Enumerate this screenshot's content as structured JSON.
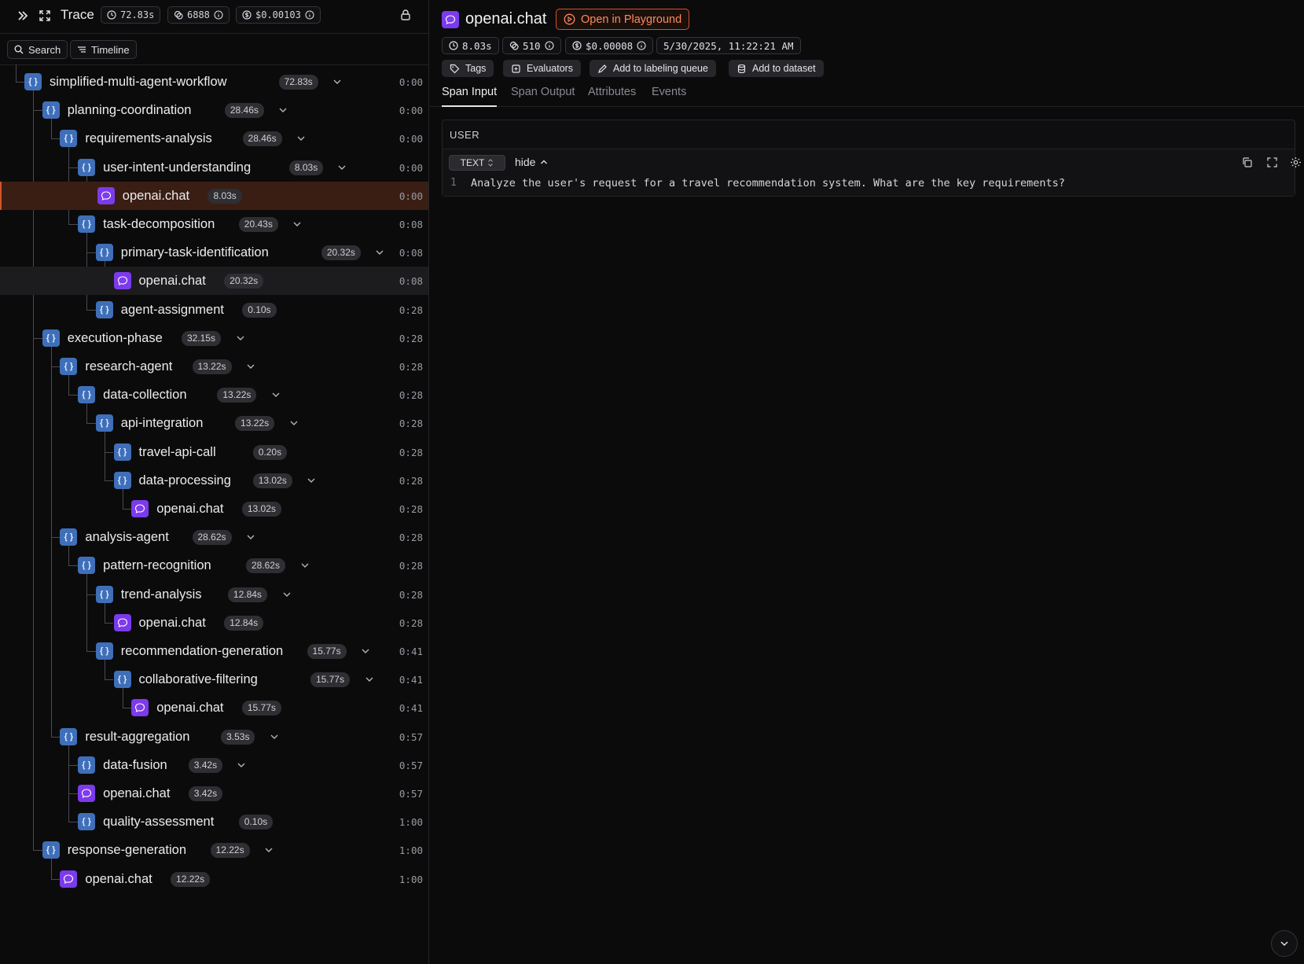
{
  "topbar": {
    "title": "Trace",
    "duration": "72.83s",
    "tokens": "6888",
    "cost": "$0.00103"
  },
  "subbar": {
    "search_label": "Search",
    "timeline_label": "Timeline"
  },
  "tree": [
    {
      "name": "simplified-multi-agent-workflow",
      "kind": "fn",
      "dur": "72.83s",
      "ts": "0:00",
      "expand": true
    },
    {
      "name": "planning-coordination",
      "kind": "fn",
      "dur": "28.46s",
      "ts": "0:00",
      "expand": true
    },
    {
      "name": "requirements-analysis",
      "kind": "fn",
      "dur": "28.46s",
      "ts": "0:00",
      "expand": true
    },
    {
      "name": "user-intent-understanding",
      "kind": "fn",
      "dur": "8.03s",
      "ts": "0:00",
      "expand": true
    },
    {
      "name": "openai.chat",
      "kind": "chat",
      "dur": "8.03s",
      "ts": "0:00",
      "expand": false
    },
    {
      "name": "task-decomposition",
      "kind": "fn",
      "dur": "20.43s",
      "ts": "0:08",
      "expand": true
    },
    {
      "name": "primary-task-identification",
      "kind": "fn",
      "dur": "20.32s",
      "ts": "0:08",
      "expand": true
    },
    {
      "name": "openai.chat",
      "kind": "chat",
      "dur": "20.32s",
      "ts": "0:08",
      "expand": false
    },
    {
      "name": "agent-assignment",
      "kind": "fn",
      "dur": "0.10s",
      "ts": "0:28",
      "expand": false
    },
    {
      "name": "execution-phase",
      "kind": "fn",
      "dur": "32.15s",
      "ts": "0:28",
      "expand": true
    },
    {
      "name": "research-agent",
      "kind": "fn",
      "dur": "13.22s",
      "ts": "0:28",
      "expand": true
    },
    {
      "name": "data-collection",
      "kind": "fn",
      "dur": "13.22s",
      "ts": "0:28",
      "expand": true
    },
    {
      "name": "api-integration",
      "kind": "fn",
      "dur": "13.22s",
      "ts": "0:28",
      "expand": true
    },
    {
      "name": "travel-api-call",
      "kind": "fn",
      "dur": "0.20s",
      "ts": "0:28",
      "expand": false
    },
    {
      "name": "data-processing",
      "kind": "fn",
      "dur": "13.02s",
      "ts": "0:28",
      "expand": true
    },
    {
      "name": "openai.chat",
      "kind": "chat",
      "dur": "13.02s",
      "ts": "0:28",
      "expand": false
    },
    {
      "name": "analysis-agent",
      "kind": "fn",
      "dur": "28.62s",
      "ts": "0:28",
      "expand": true
    },
    {
      "name": "pattern-recognition",
      "kind": "fn",
      "dur": "28.62s",
      "ts": "0:28",
      "expand": true
    },
    {
      "name": "trend-analysis",
      "kind": "fn",
      "dur": "12.84s",
      "ts": "0:28",
      "expand": true
    },
    {
      "name": "openai.chat",
      "kind": "chat",
      "dur": "12.84s",
      "ts": "0:28",
      "expand": false
    },
    {
      "name": "recommendation-generation",
      "kind": "fn",
      "dur": "15.77s",
      "ts": "0:41",
      "expand": true
    },
    {
      "name": "collaborative-filtering",
      "kind": "fn",
      "dur": "15.77s",
      "ts": "0:41",
      "expand": true
    },
    {
      "name": "openai.chat",
      "kind": "chat",
      "dur": "15.77s",
      "ts": "0:41",
      "expand": false
    },
    {
      "name": "result-aggregation",
      "kind": "fn",
      "dur": "3.53s",
      "ts": "0:57",
      "expand": true
    },
    {
      "name": "data-fusion",
      "kind": "fn",
      "dur": "3.42s",
      "ts": "0:57",
      "expand": true
    },
    {
      "name": "openai.chat",
      "kind": "chat",
      "dur": "3.42s",
      "ts": "0:57",
      "expand": false
    },
    {
      "name": "quality-assessment",
      "kind": "fn",
      "dur": "0.10s",
      "ts": "1:00",
      "expand": false
    },
    {
      "name": "response-generation",
      "kind": "fn",
      "dur": "12.22s",
      "ts": "1:00",
      "expand": true
    },
    {
      "name": "openai.chat",
      "kind": "chat",
      "dur": "12.22s",
      "ts": "1:00",
      "expand": false
    }
  ],
  "detail": {
    "title": "openai.chat",
    "playground_label": "Open in Playground",
    "duration": "8.03s",
    "tokens": "510",
    "cost": "$0.00008",
    "timestamp": "5/30/2025, 11:22:21 AM",
    "actions": {
      "tags": "Tags",
      "evaluators": "Evaluators",
      "labeling": "Add to labeling queue",
      "dataset": "Add to dataset"
    },
    "tabs": [
      "Span Input",
      "Span Output",
      "Attributes",
      "Events"
    ],
    "role": "USER",
    "format": "TEXT",
    "hide_label": "hide",
    "line_number": "1",
    "line_text": "Analyze the user's request for a travel recommendation system. What are the key requirements?"
  },
  "colors": {
    "accent": "#d2532a",
    "fn_icon": "#3f6fb8",
    "chat_icon": "#7c3aed",
    "selected_row": "#3a1e14"
  }
}
